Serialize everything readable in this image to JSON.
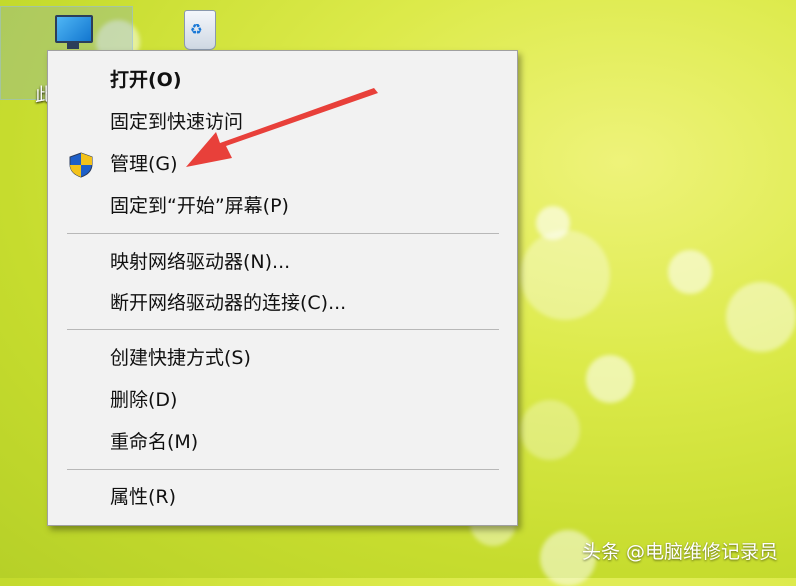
{
  "desktop": {
    "this_pc_label_fragment": "此",
    "accent_color": "#dfe94a"
  },
  "context_menu": {
    "items": [
      {
        "label": "打开(O)",
        "bold": true
      },
      {
        "label": "固定到快速访问"
      },
      {
        "label": "管理(G)",
        "icon": "uac-shield-icon"
      },
      {
        "label": "固定到“开始”屏幕(P)"
      },
      {
        "label": "映射网络驱动器(N)..."
      },
      {
        "label": "断开网络驱动器的连接(C)..."
      },
      {
        "label": "创建快捷方式(S)"
      },
      {
        "label": "删除(D)"
      },
      {
        "label": "重命名(M)"
      },
      {
        "label": "属性(R)"
      }
    ]
  },
  "annotation": {
    "arrow_color": "#e8403a",
    "points_to": "管理(G)"
  },
  "watermark": "头条 @电脑维修记录员"
}
